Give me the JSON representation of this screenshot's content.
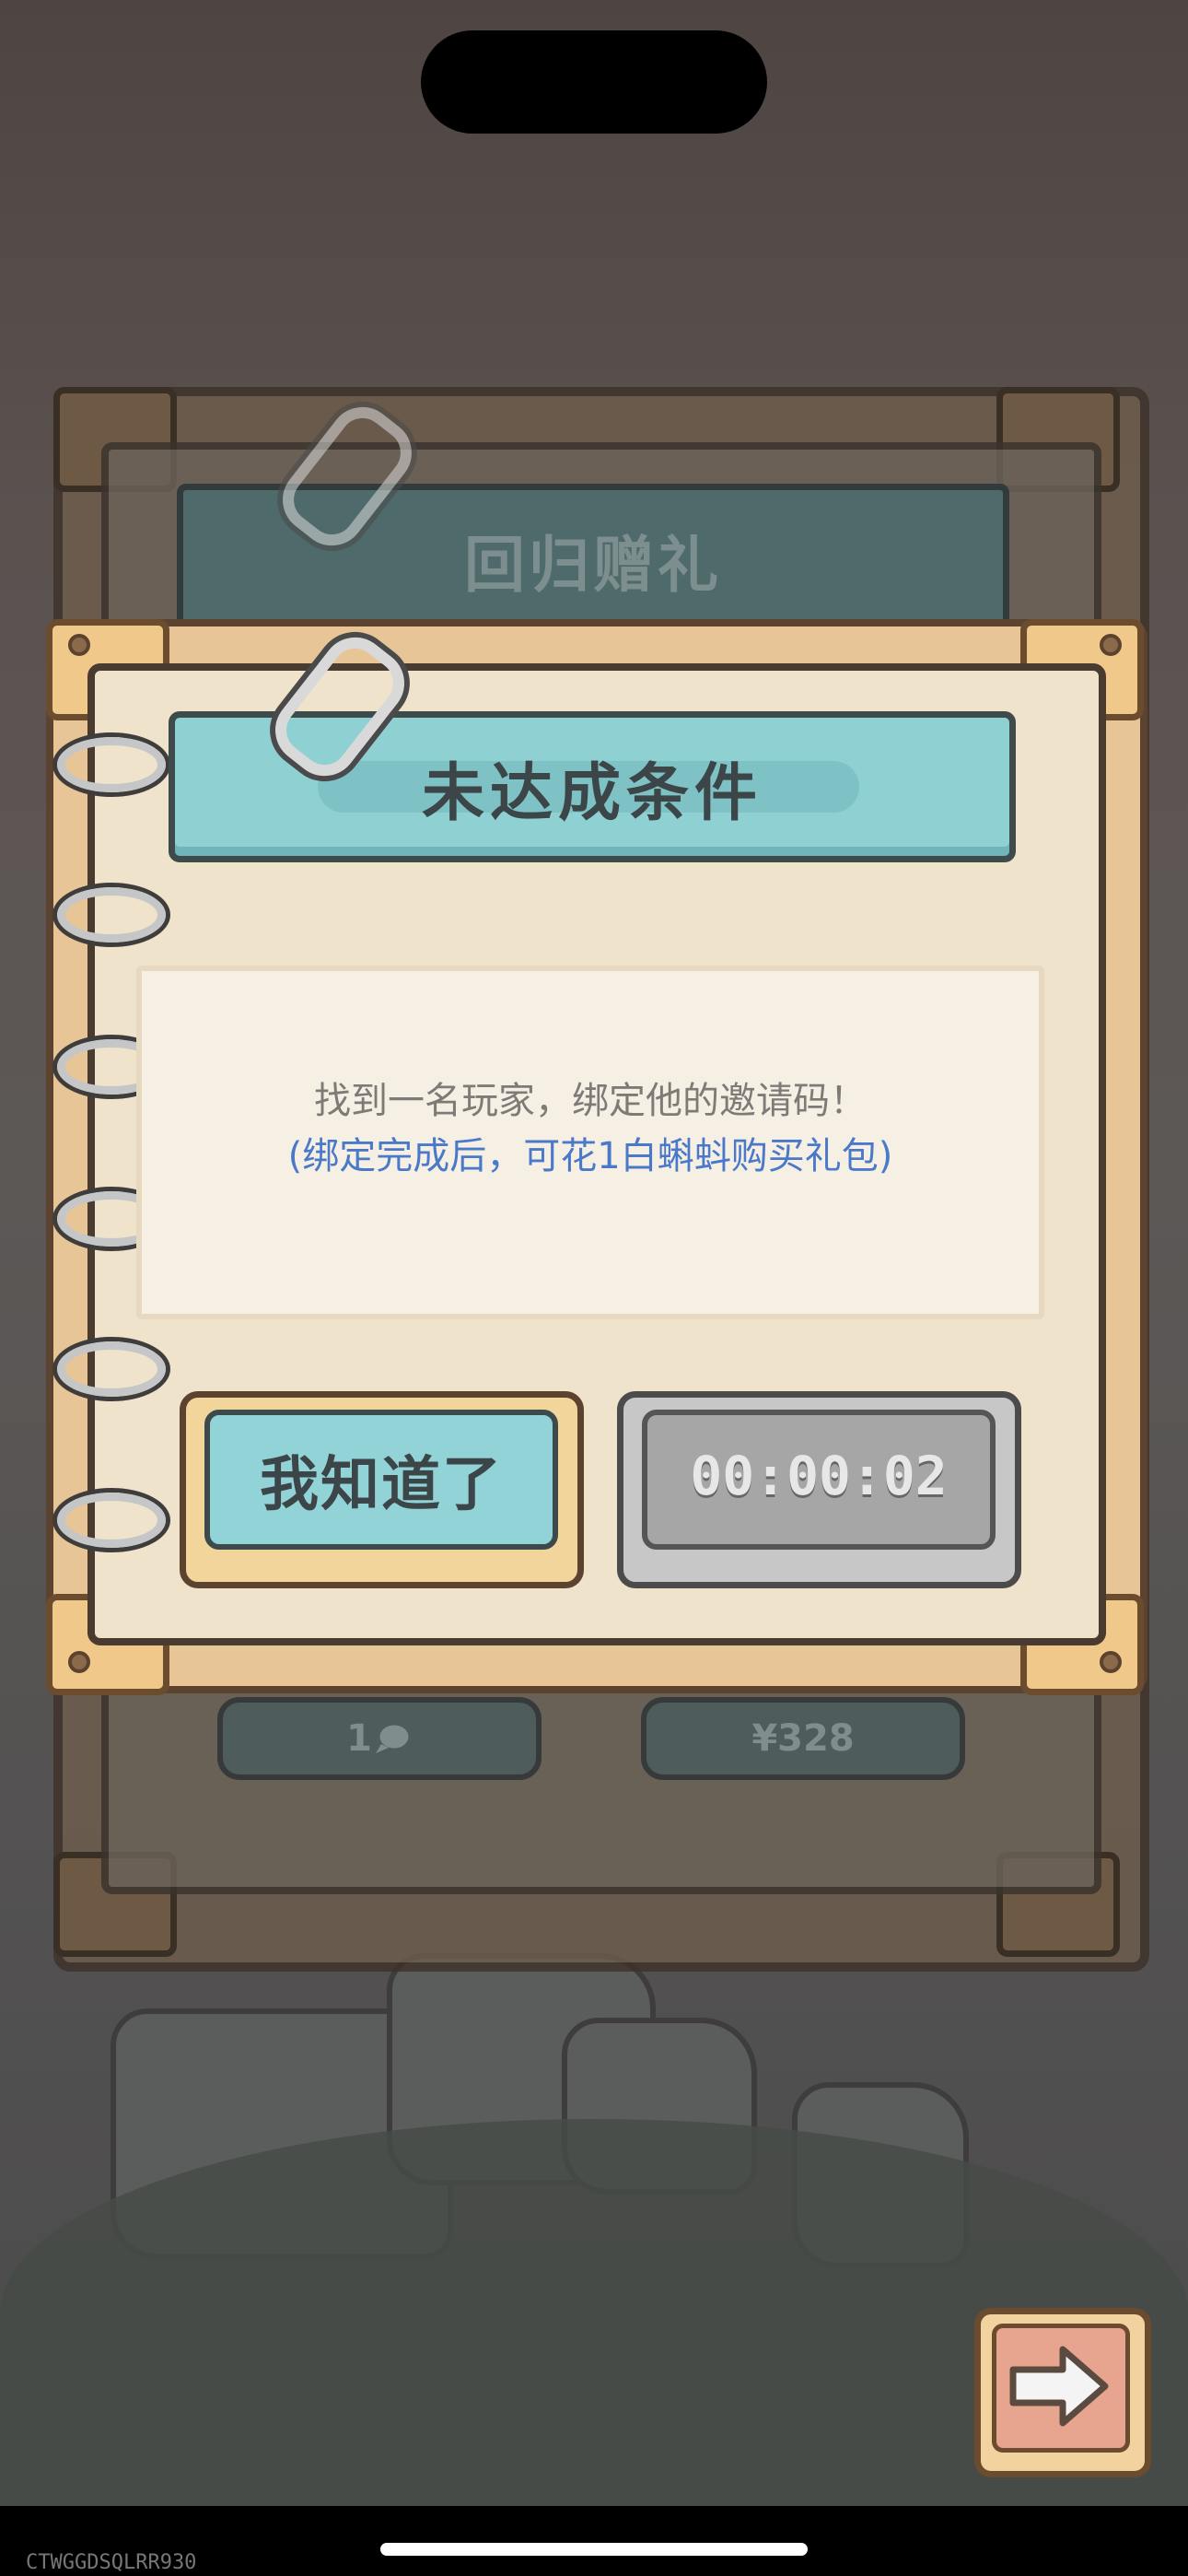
{
  "background_panel": {
    "title": "回归赠礼",
    "pill_left": "1",
    "pill_right": "¥328"
  },
  "dialog": {
    "title": "未达成条件",
    "message": "找到一名玩家，绑定他的邀请码！",
    "note": "(绑定完成后，可花1白蝌蚪购买礼包)",
    "confirm_label": "我知道了",
    "timer_label": "00:00:02"
  },
  "icons": {
    "clip": "paperclip-icon",
    "next": "arrow-right-icon",
    "currency": "speech-bubble-icon"
  },
  "colors": {
    "title_banner": "#8fd0d3",
    "confirm_button": "#92d3d8",
    "timer_button": "#a6a6a6",
    "note_text": "#4b79c9"
  },
  "watermark": "CTWGGDSQLRR930"
}
